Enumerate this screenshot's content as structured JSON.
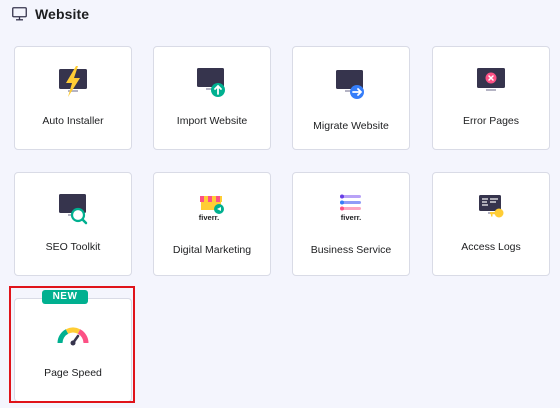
{
  "section": {
    "title": "Website",
    "icon": "monitor-icon"
  },
  "cards": [
    {
      "label": "Auto Installer",
      "icon": "lightning-monitor-icon"
    },
    {
      "label": "Import Website",
      "icon": "upload-monitor-icon"
    },
    {
      "label": "Migrate Website",
      "icon": "migrate-monitor-icon"
    },
    {
      "label": "Error Pages",
      "icon": "error-monitor-icon"
    },
    {
      "label": "SEO Toolkit",
      "icon": "seo-search-monitor-icon"
    },
    {
      "label": "Digital Marketing",
      "icon": "fiverr-storefront-icon",
      "brand": "fiverr."
    },
    {
      "label": "Business Service",
      "icon": "fiverr-list-icon",
      "brand": "fiverr."
    },
    {
      "label": "Access Logs",
      "icon": "key-document-icon"
    },
    {
      "label": "Page Speed",
      "icon": "speedometer-icon",
      "badge": "NEW"
    }
  ],
  "colors": {
    "accent_purple": "#673de6",
    "monitor_dark": "#36344d",
    "success_green": "#00b090",
    "error_red": "#fc5185",
    "warning_yellow": "#ffcd35",
    "highlight_red": "#e0131a"
  }
}
